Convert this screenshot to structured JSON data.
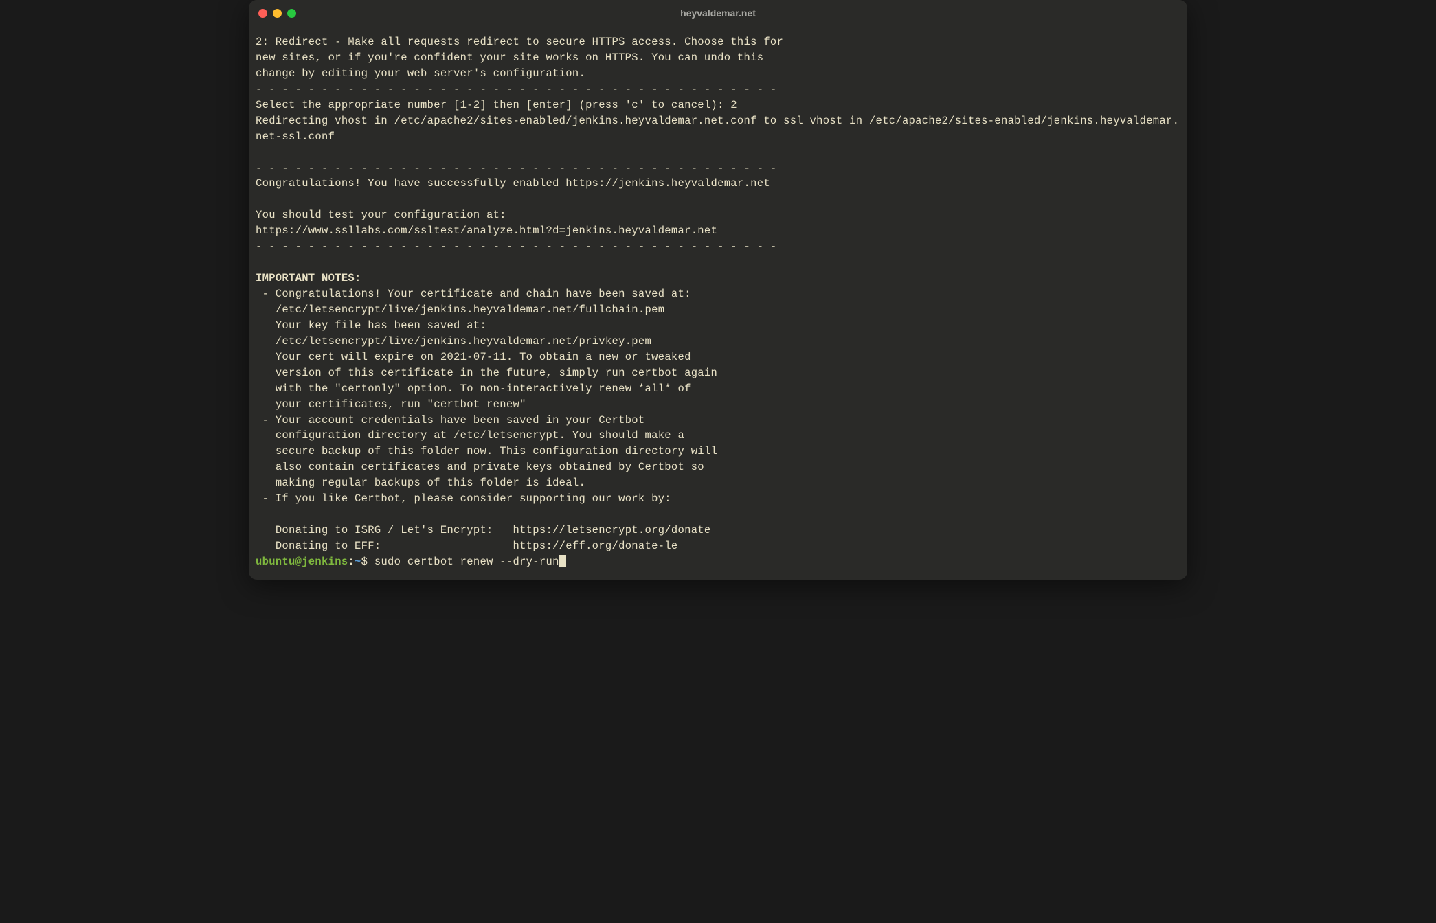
{
  "window": {
    "title": "heyvaldemar.net"
  },
  "terminal": {
    "lines": {
      "l1": "2: Redirect - Make all requests redirect to secure HTTPS access. Choose this for",
      "l2": "new sites, or if you're confident your site works on HTTPS. You can undo this",
      "l3": "change by editing your web server's configuration.",
      "l4": "- - - - - - - - - - - - - - - - - - - - - - - - - - - - - - - - - - - - - - - -",
      "l5": "Select the appropriate number [1-2] then [enter] (press 'c' to cancel): 2",
      "l6": "Redirecting vhost in /etc/apache2/sites-enabled/jenkins.heyvaldemar.net.conf to ssl vhost in /etc/apache2/sites-enabled/jenkins.heyvaldemar.net-ssl.conf",
      "l7": "",
      "l8": "- - - - - - - - - - - - - - - - - - - - - - - - - - - - - - - - - - - - - - - -",
      "l9": "Congratulations! You have successfully enabled https://jenkins.heyvaldemar.net",
      "l10": "",
      "l11": "You should test your configuration at:",
      "l12": "https://www.ssllabs.com/ssltest/analyze.html?d=jenkins.heyvaldemar.net",
      "l13": "- - - - - - - - - - - - - - - - - - - - - - - - - - - - - - - - - - - - - - - -",
      "l14": "",
      "l15": "IMPORTANT NOTES:",
      "l16": " - Congratulations! Your certificate and chain have been saved at:",
      "l17": "   /etc/letsencrypt/live/jenkins.heyvaldemar.net/fullchain.pem",
      "l18": "   Your key file has been saved at:",
      "l19": "   /etc/letsencrypt/live/jenkins.heyvaldemar.net/privkey.pem",
      "l20": "   Your cert will expire on 2021-07-11. To obtain a new or tweaked",
      "l21": "   version of this certificate in the future, simply run certbot again",
      "l22": "   with the \"certonly\" option. To non-interactively renew *all* of",
      "l23": "   your certificates, run \"certbot renew\"",
      "l24": " - Your account credentials have been saved in your Certbot",
      "l25": "   configuration directory at /etc/letsencrypt. You should make a",
      "l26": "   secure backup of this folder now. This configuration directory will",
      "l27": "   also contain certificates and private keys obtained by Certbot so",
      "l28": "   making regular backups of this folder is ideal.",
      "l29": " - If you like Certbot, please consider supporting our work by:",
      "l30": "",
      "l31": "   Donating to ISRG / Let's Encrypt:   https://letsencrypt.org/donate",
      "l32": "   Donating to EFF:                    https://eff.org/donate-le"
    },
    "prompt": {
      "user_host": "ubuntu@jenkins",
      "colon": ":",
      "path": "~",
      "dollar": "$ ",
      "command": "sudo certbot renew --dry-run"
    }
  }
}
